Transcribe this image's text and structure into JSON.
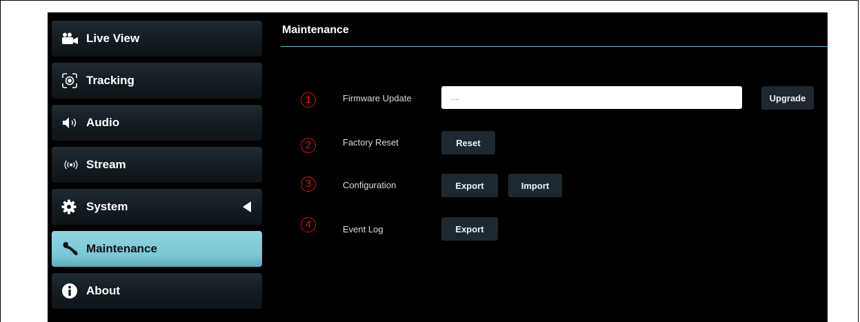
{
  "sidebar": {
    "items": [
      {
        "label": "Live View",
        "icon": "video-camera-icon"
      },
      {
        "label": "Tracking",
        "icon": "tracking-target-icon"
      },
      {
        "label": "Audio",
        "icon": "speaker-icon"
      },
      {
        "label": "Stream",
        "icon": "broadcast-icon"
      },
      {
        "label": "System",
        "icon": "gear-icon",
        "expand_icon": "triangle-left-icon"
      },
      {
        "label": "Maintenance",
        "icon": "wrench-icon",
        "active": true
      },
      {
        "label": "About",
        "icon": "info-icon"
      }
    ]
  },
  "main": {
    "title": "Maintenance",
    "rows": [
      {
        "num": "1",
        "label": "Firmware Update",
        "input_value": "....",
        "button": "Upgrade"
      },
      {
        "num": "2",
        "label": "Factory Reset",
        "button": "Reset"
      },
      {
        "num": "3",
        "label": "Configuration",
        "button": "Export",
        "button2": "Import"
      },
      {
        "num": "4",
        "label": "Event Log",
        "button": "Export"
      }
    ]
  },
  "colors": {
    "background": "#000000",
    "accent": "#7ac8d4",
    "annotation_red": "#e8141b"
  }
}
